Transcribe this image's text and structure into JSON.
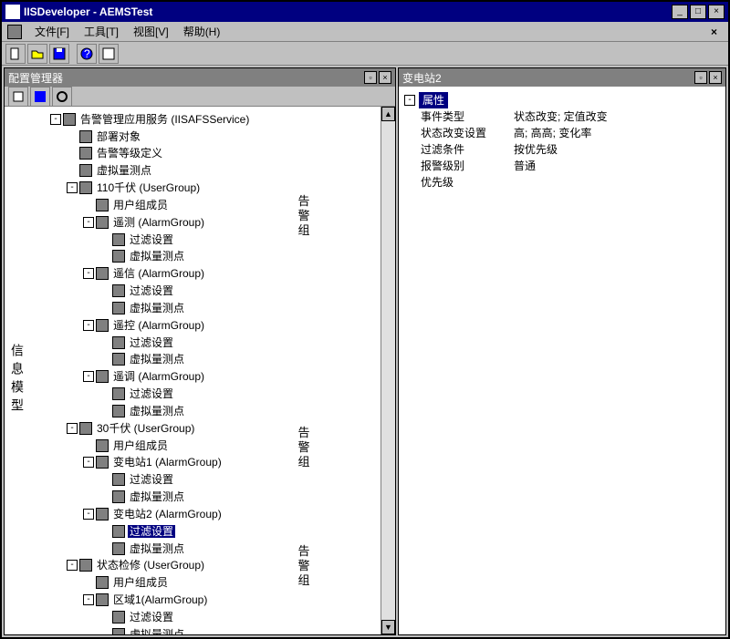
{
  "window": {
    "title": "IISDeveloper - AEMSTest",
    "buttons": {
      "min": "_",
      "max": "□",
      "close": "×"
    }
  },
  "menu": {
    "file": "文件[F]",
    "tools": "工具[T]",
    "view": "视图[V]",
    "help": "帮助(H)",
    "close": "×"
  },
  "left_panel": {
    "title": "配置管理器",
    "side_label_info": "信息模型",
    "side_label_alarm": "告警组",
    "tree": {
      "root": "告警管理应用服务 (IISAFSService)",
      "deploy": "部署对象",
      "alarm_level": "告警等级定义",
      "virtual_point": "虚拟量测点",
      "group_110": "110千伏 (UserGroup)",
      "members": "用户组成员",
      "telemetry": "遥测 (AlarmGroup)",
      "filter": "过滤设置",
      "vpoint": "虚拟量测点",
      "telemsg": "遥信 (AlarmGroup)",
      "telecontrol": "遥控 (AlarmGroup)",
      "teleadjust": "遥调 (AlarmGroup)",
      "group_30": "30千伏 (UserGroup)",
      "substation1": "变电站1 (AlarmGroup)",
      "substation2": "变电站2 (AlarmGroup)",
      "filter_sel": "过滤设置",
      "status_repair": "状态检修 (UserGroup)",
      "zone1": "区域1(AlarmGroup)"
    }
  },
  "right_panel": {
    "title": "变电站2",
    "category": "属性",
    "rows": [
      {
        "k": "事件类型",
        "v": "状态改变; 定值改变"
      },
      {
        "k": "状态改变设置",
        "v": "高; 高高; 变化率"
      },
      {
        "k": "过滤条件",
        "v": "按优先级"
      },
      {
        "k": "报警级别",
        "v": "普通"
      },
      {
        "k": "优先级",
        "v": ""
      }
    ]
  }
}
